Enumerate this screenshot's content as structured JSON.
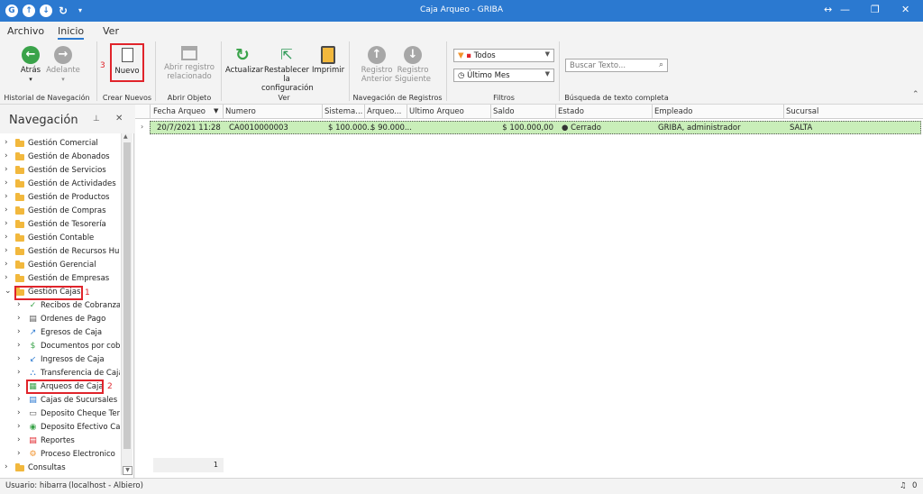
{
  "window": {
    "title": "Caja Arqueo - GRIBA",
    "qa_app": "G"
  },
  "menubar": {
    "items": [
      "Archivo",
      "Inicio",
      "Ver"
    ]
  },
  "ribbon": {
    "buttons": {
      "back": "Atrás",
      "forward": "Adelante",
      "new": "Nuevo",
      "open_related": "Abrir registro relacionado",
      "refresh": "Actualizar",
      "reset": "Restablecer la configuración",
      "print": "Imprimir",
      "prev": "Registro Anterior",
      "next": "Registro Siguiente"
    },
    "groups": {
      "history": "Historial de Navegación",
      "create": "Crear Nuevos",
      "open": "Abrir Objeto",
      "view": "Ver",
      "recnav": "Navegación de Registros",
      "filters": "Filtros",
      "search": "Búsqueda de texto completa"
    },
    "filters": {
      "status": "Todos",
      "period": "Último Mes"
    },
    "search": {
      "placeholder": "Buscar Texto..."
    }
  },
  "nav": {
    "title": "Navegación",
    "items": [
      {
        "label": "Gestión Comercial",
        "level": 0,
        "icon": "folder-icon"
      },
      {
        "label": "Gestión de Abonados",
        "level": 0,
        "icon": "folder-icon"
      },
      {
        "label": "Gestión de Servicios",
        "level": 0,
        "icon": "folder-icon"
      },
      {
        "label": "Gestión de Actividades",
        "level": 0,
        "icon": "folder-icon"
      },
      {
        "label": "Gestión de Productos",
        "level": 0,
        "icon": "folder-icon"
      },
      {
        "label": "Gestión de Compras",
        "level": 0,
        "icon": "folder-icon"
      },
      {
        "label": "Gestión de Tesorería",
        "level": 0,
        "icon": "folder-icon"
      },
      {
        "label": "Gestión Contable",
        "level": 0,
        "icon": "folder-icon"
      },
      {
        "label": "Gestión de Recursos Hum...",
        "level": 0,
        "icon": "folder-icon"
      },
      {
        "label": "Gestión Gerencial",
        "level": 0,
        "icon": "folder-icon"
      },
      {
        "label": "Gestión de Empresas",
        "level": 0,
        "icon": "folder-icon"
      },
      {
        "label": "Gestión Cajas",
        "level": 0,
        "icon": "folder-icon",
        "expanded": true
      },
      {
        "label": "Recibos de Cobranza",
        "level": 1,
        "icon": "receipt-icon"
      },
      {
        "label": "Ordenes de Pago",
        "level": 1,
        "icon": "payment-order-icon"
      },
      {
        "label": "Egresos de Caja",
        "level": 1,
        "icon": "arrow-out-icon"
      },
      {
        "label": "Documentos por cobrar",
        "level": 1,
        "icon": "document-money-icon"
      },
      {
        "label": "Ingresos de Caja",
        "level": 1,
        "icon": "arrow-in-icon"
      },
      {
        "label": "Transferencia de Caja",
        "level": 1,
        "icon": "transfer-icon"
      },
      {
        "label": "Arqueos de Caja",
        "level": 1,
        "icon": "cash-count-icon"
      },
      {
        "label": "Cajas de Sucursales",
        "level": 1,
        "icon": "branch-cash-icon"
      },
      {
        "label": "Deposito Cheque Ter...",
        "level": 1,
        "icon": "check-deposit-icon"
      },
      {
        "label": "Deposito Efectivo Caj...",
        "level": 1,
        "icon": "cash-deposit-icon"
      },
      {
        "label": "Reportes",
        "level": 1,
        "icon": "report-icon"
      },
      {
        "label": "Proceso Electronico",
        "level": 1,
        "icon": "process-icon"
      },
      {
        "label": "Consultas",
        "level": 0,
        "icon": "folder-icon"
      }
    ]
  },
  "grid": {
    "columns": [
      "Fecha Arqueo",
      "Numero",
      "Sistema...",
      "Arqueo...",
      "Ultimo Arqueo",
      "Saldo",
      "Estado",
      "Empleado",
      "Sucursal"
    ],
    "rows": [
      [
        "20/7/2021 11:28",
        "CA0010000003",
        "$ 100.000...",
        "$ 90.000...",
        "",
        "$ 100.000,00",
        "Cerrado",
        "GRIBA, administrador",
        "SALTA"
      ]
    ],
    "count": "1"
  },
  "annotations": {
    "nav_group": "1",
    "nav_item": "2",
    "new_button": "3"
  },
  "status": {
    "user": "Usuario: hibarra",
    "server": "(localhost - Albiero)",
    "notifications": "0"
  },
  "colors": {
    "accent": "#2b79d0",
    "row_highlight": "#c9eeb9",
    "annotation": "#e0242b",
    "back": "#3aa34a"
  }
}
